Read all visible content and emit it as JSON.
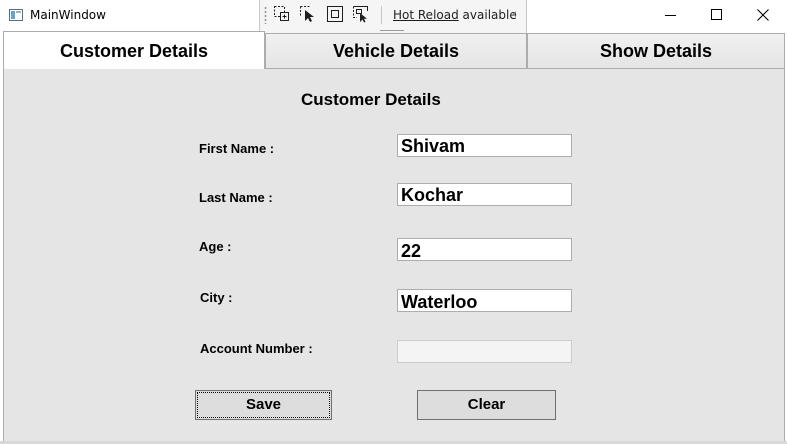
{
  "window": {
    "title": "MainWindow",
    "icon": "window-app-icon",
    "controls": [
      "minimize-icon",
      "maximize-icon",
      "close-icon"
    ]
  },
  "debug_toolbar": {
    "icons": [
      "select-element-icon",
      "pointer-select-icon",
      "display-layout-adorners-icon",
      "track-focus-icon"
    ],
    "hot_reload_link": "Hot Reload",
    "hot_reload_status": "available",
    "collapse_glyph": "‹"
  },
  "tabs": [
    {
      "label": "Customer Details",
      "active": true
    },
    {
      "label": "Vehicle Details",
      "active": false
    },
    {
      "label": "Show Details",
      "active": false
    }
  ],
  "form": {
    "heading": "Customer Details",
    "fields": [
      {
        "label": "First Name :",
        "value": "Shivam"
      },
      {
        "label": "Last Name :",
        "value": "Kochar"
      },
      {
        "label": "Age :",
        "value": "22"
      },
      {
        "label": "City :",
        "value": "Waterloo"
      },
      {
        "label": "Account Number :",
        "value": "",
        "disabled": true
      }
    ],
    "save_label": "Save",
    "clear_label": "Clear"
  },
  "colors": {
    "panel_background": "#e5e5e5",
    "tab_border": "#acacac",
    "field_border": "#abadb3",
    "button_background": "#dddddd"
  }
}
